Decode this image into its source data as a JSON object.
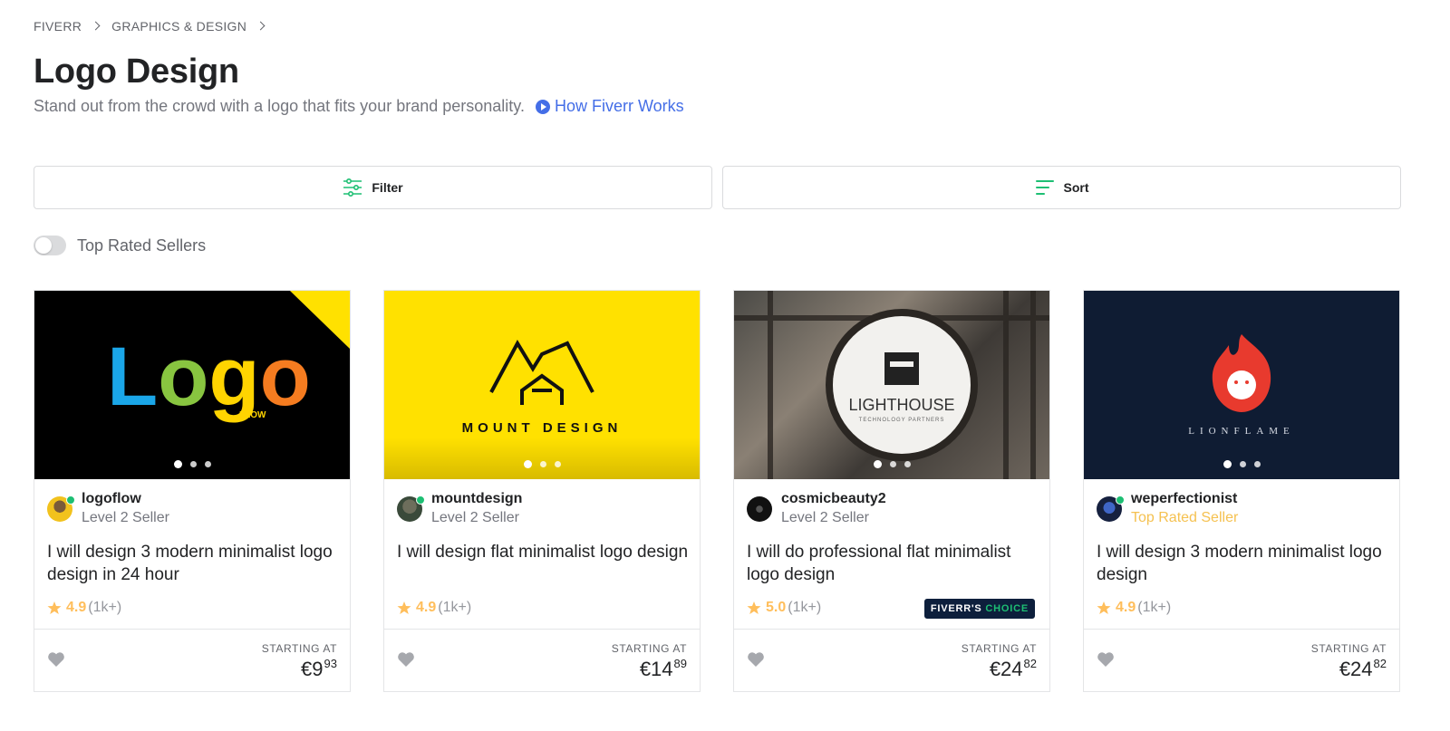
{
  "breadcrumb": {
    "item1": "FIVERR",
    "item2": "GRAPHICS & DESIGN"
  },
  "header": {
    "title": "Logo Design",
    "subtitle": "Stand out from the crowd with a logo that fits your brand personality.",
    "how_link": "How Fiverr Works",
    "accent_color": "#446ee7"
  },
  "toolbar": {
    "filter_label": "Filter",
    "sort_label": "Sort",
    "icon_color": "#1dbf73"
  },
  "toggle": {
    "label": "Top Rated Sellers",
    "on": false
  },
  "cards": [
    {
      "image_text": "Logo",
      "image_subtext": "FLOW",
      "seller_name": "logoflow",
      "seller_level": "Level 2 Seller",
      "title": "I will design 3 modern minimalist logo design in 24 hour",
      "rating": "4.9",
      "rating_count": "(1k+)",
      "starting_at": "STARTING AT",
      "price_main": "€9",
      "price_cents": "93",
      "online": true
    },
    {
      "image_text": "MOUNT DESIGN",
      "seller_name": "mountdesign",
      "seller_level": "Level 2 Seller",
      "title": "I will design flat minimalist logo design",
      "rating": "4.9",
      "rating_count": "(1k+)",
      "starting_at": "STARTING AT",
      "price_main": "€14",
      "price_cents": "89",
      "online": true
    },
    {
      "image_text": "LIGHTHOUSE",
      "image_subtext": "TECHNOLOGY PARTNERS",
      "seller_name": "cosmicbeauty2",
      "seller_level": "Level 2 Seller",
      "title": "I will do professional flat minimalist logo design",
      "rating": "5.0",
      "rating_count": "(1k+)",
      "badge_prefix": "FIVERR'S",
      "badge_suffix": "CHOICE",
      "starting_at": "STARTING AT",
      "price_main": "€24",
      "price_cents": "82",
      "online": false
    },
    {
      "image_text": "LIONFLAME",
      "seller_name": "weperfectionist",
      "seller_level": "Top Rated Seller",
      "title": "I will design 3 modern minimalist logo design",
      "rating": "4.9",
      "rating_count": "(1k+)",
      "starting_at": "STARTING AT",
      "price_main": "€24",
      "price_cents": "82",
      "online": true
    }
  ],
  "icons": {
    "breadcrumb_separator": "chevron-right-icon",
    "how_link": "play-circle-icon",
    "filter": "sliders-icon",
    "sort": "sort-lines-icon",
    "rating": "star-icon",
    "favorite": "heart-icon"
  }
}
